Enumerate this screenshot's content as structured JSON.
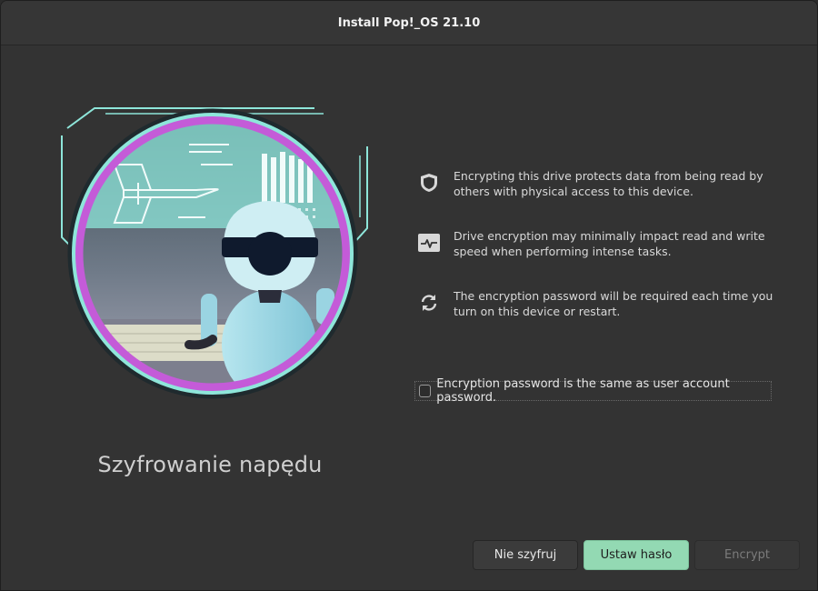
{
  "window": {
    "title": "Install Pop!_OS 21.10"
  },
  "page": {
    "heading": "Szyfrowanie napędu"
  },
  "info_items": [
    {
      "icon": "shield-icon",
      "text": "Encrypting this drive protects data from being read by others with physical access to this device."
    },
    {
      "icon": "activity-monitor-icon",
      "text": "Drive encryption may minimally impact read and write speed when performing intense tasks."
    },
    {
      "icon": "refresh-icon",
      "text": "The encryption password will be required each time you turn on this device or restart."
    }
  ],
  "options": {
    "same_password_label": "Encryption password is the same as user account password.",
    "same_password_checked": false
  },
  "buttons": {
    "no_encrypt": "Nie szyfruj",
    "set_password": "Ustaw hasło",
    "encrypt": "Encrypt"
  },
  "colors": {
    "accent": "#93d9b3",
    "window_bg": "#333333",
    "illustration_ring": "#c45bd8",
    "illustration_teal": "#8ee6da"
  }
}
